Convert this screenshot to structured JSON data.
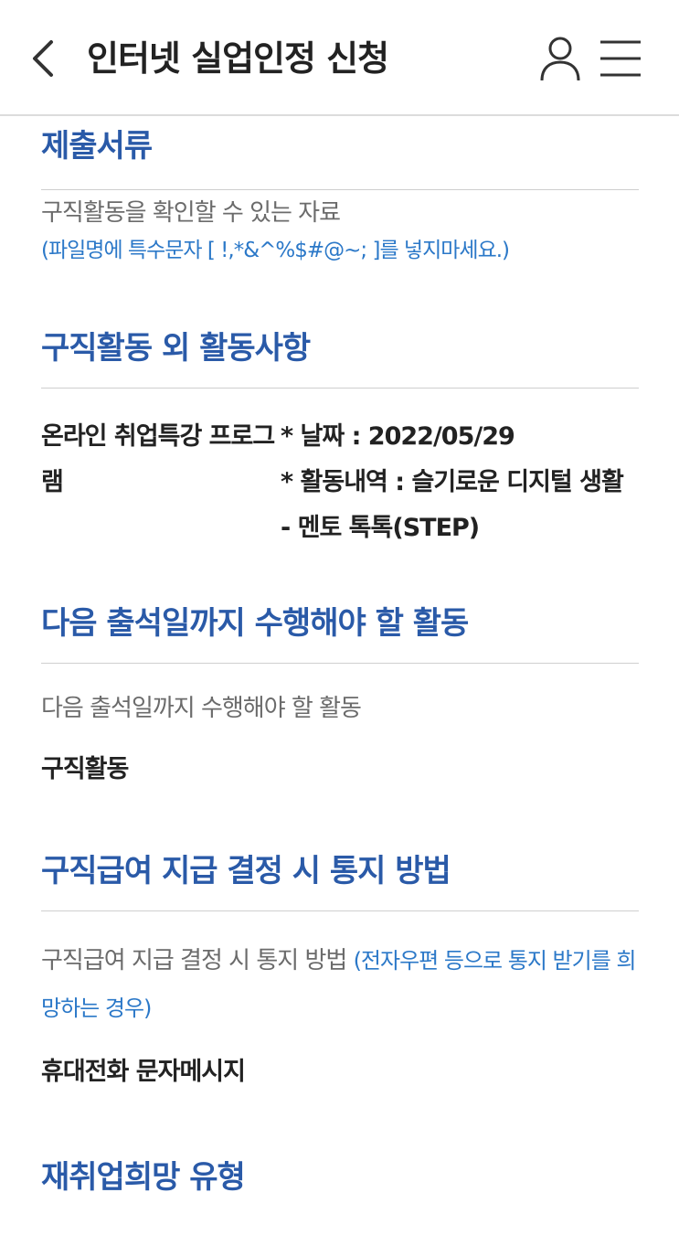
{
  "header": {
    "title": "인터넷 실업인정 신청",
    "back_icon": "chevron-left-icon",
    "user_icon": "user-icon",
    "menu_icon": "hamburger-menu-icon"
  },
  "sections": {
    "documents": {
      "title": "제출서류",
      "label": "구직활동을 확인할 수 있는 자료",
      "hint": "(파일명에 특수문자 [ !,*&^%$#@~; ]를 넣지마세요.)"
    },
    "other_activities": {
      "title": "구직활동 외 활동사항",
      "activity_name": "온라인 취업특강 프로그램",
      "date_line": "* 날짜 : 2022/05/29",
      "detail_line": "* 활동내역 : 슬기로운 디지털 생활 - 멘토 톡톡(STEP)"
    },
    "next_activity": {
      "title": "다음 출석일까지 수행해야 할 활동",
      "label": "다음 출석일까지 수행해야 할 활동",
      "value": "구직활동"
    },
    "notification": {
      "title": "구직급여 지급 결정 시 통지 방법",
      "label": "구직급여 지급 결정 시 통지 방법",
      "hint": "(전자우편 등으로 통지 받기를 희망하는 경우)",
      "value": "휴대전화 문자메시지"
    },
    "reemployment": {
      "title": "재취업희망 유형"
    }
  },
  "colors": {
    "section_title": "#2a5aa8",
    "hint": "#2b78c8",
    "label": "#6b6b6b",
    "value": "#222222",
    "divider": "#cfcfcf"
  }
}
